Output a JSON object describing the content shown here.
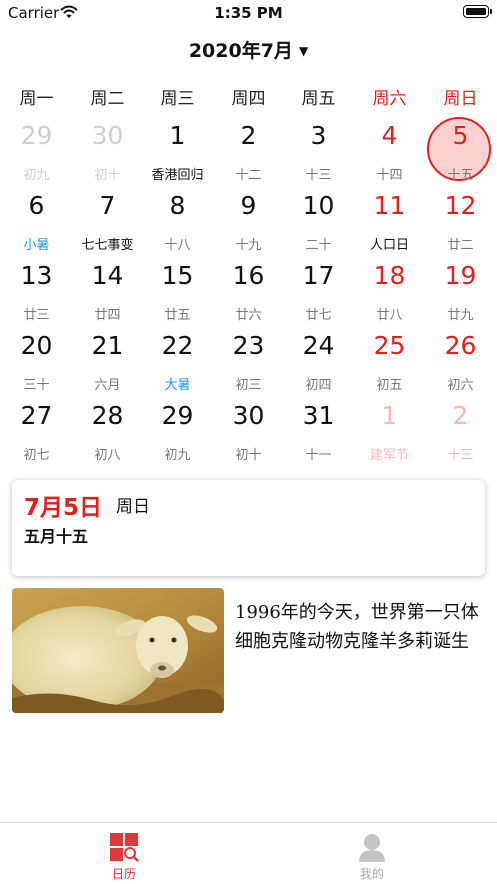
{
  "status_bar": {
    "carrier": "Carrier",
    "time": "1:35 PM"
  },
  "header": {
    "month_title": "2020年7月",
    "caret": "▼"
  },
  "weekdays": [
    "周一",
    "周二",
    "周三",
    "周四",
    "周五",
    "周六",
    "周日"
  ],
  "calendar": {
    "selected_day": "5",
    "weeks": [
      [
        {
          "day": "29",
          "sub": "初九"
        },
        {
          "day": "30",
          "sub": "初十"
        },
        {
          "day": "1",
          "sub": "香港回归"
        },
        {
          "day": "2",
          "sub": "十二"
        },
        {
          "day": "3",
          "sub": "十三"
        },
        {
          "day": "4",
          "sub": "十四"
        },
        {
          "day": "5",
          "sub": "十五"
        }
      ],
      [
        {
          "day": "6",
          "sub": "小暑"
        },
        {
          "day": "7",
          "sub": "七七事变"
        },
        {
          "day": "8",
          "sub": "十八"
        },
        {
          "day": "9",
          "sub": "十九"
        },
        {
          "day": "10",
          "sub": "二十"
        },
        {
          "day": "11",
          "sub": "人口日"
        },
        {
          "day": "12",
          "sub": "廿二"
        }
      ],
      [
        {
          "day": "13",
          "sub": "廿三"
        },
        {
          "day": "14",
          "sub": "廿四"
        },
        {
          "day": "15",
          "sub": "廿五"
        },
        {
          "day": "16",
          "sub": "廿六"
        },
        {
          "day": "17",
          "sub": "廿七"
        },
        {
          "day": "18",
          "sub": "廿八"
        },
        {
          "day": "19",
          "sub": "廿九"
        }
      ],
      [
        {
          "day": "20",
          "sub": "三十"
        },
        {
          "day": "21",
          "sub": "六月"
        },
        {
          "day": "22",
          "sub": "大暑"
        },
        {
          "day": "23",
          "sub": "初三"
        },
        {
          "day": "24",
          "sub": "初四"
        },
        {
          "day": "25",
          "sub": "初五"
        },
        {
          "day": "26",
          "sub": "初六"
        }
      ],
      [
        {
          "day": "27",
          "sub": "初七"
        },
        {
          "day": "28",
          "sub": "初八"
        },
        {
          "day": "29",
          "sub": "初九"
        },
        {
          "day": "30",
          "sub": "初十"
        },
        {
          "day": "31",
          "sub": "十一"
        },
        {
          "day": "1",
          "sub": "建军节"
        },
        {
          "day": "2",
          "sub": "十三"
        }
      ]
    ]
  },
  "detail": {
    "date": "7月5日",
    "weekday": "周日",
    "lunar": "五月十五"
  },
  "history": {
    "text": "1996年的今天，世界第一只体细胞克隆动物克隆羊多莉诞生"
  },
  "tabs": [
    {
      "label": "日历"
    },
    {
      "label": "我的"
    }
  ],
  "colors": {
    "accent_red": "#e02020",
    "solar_term_blue": "#1e9be0",
    "muted_gray": "#cfcfcf"
  }
}
